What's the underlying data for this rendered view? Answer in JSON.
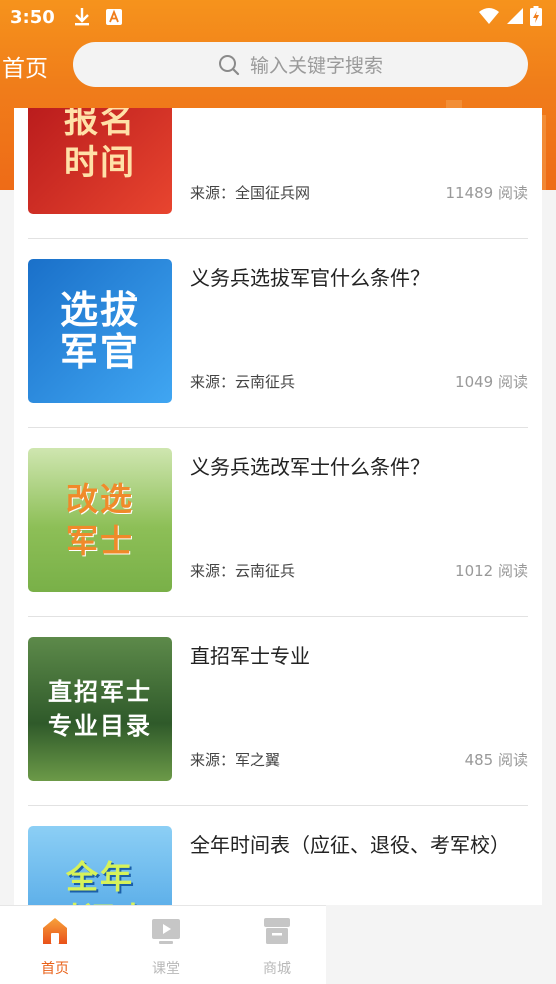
{
  "status_bar": {
    "time": "3:50",
    "download_icon": "download-icon",
    "notification_icon": "font-app-icon",
    "wifi_icon": "wifi-icon",
    "signal_icon": "signal-icon",
    "battery_icon": "battery-charging-icon"
  },
  "header": {
    "title": "首页",
    "search_placeholder": "输入关键字搜索"
  },
  "articles": [
    {
      "title": "",
      "thumb_text": "报名\n时间",
      "source": "来源：全国征兵网",
      "reads": "11489 阅读",
      "thumb_colors": [
        "#c21f1f",
        "#e34b2e"
      ]
    },
    {
      "title": "义务兵选拔军官什么条件？",
      "thumb_text": "选拔\n军官",
      "source": "来源：云南征兵",
      "reads": "1049 阅读",
      "thumb_colors": [
        "#1e7fd6",
        "#3aa0ef"
      ]
    },
    {
      "title": "义务兵选改军士什么条件？",
      "thumb_text": "改选\n军士",
      "source": "来源：云南征兵",
      "reads": "1012 阅读",
      "thumb_colors": [
        "#8fc25a",
        "#b6d98a"
      ]
    },
    {
      "title": "直招军士专业",
      "thumb_text": "直招军士\n专业目录",
      "source": "来源：军之翼",
      "reads": "485 阅读",
      "thumb_colors": [
        "#3e6b34",
        "#7ea55b"
      ]
    },
    {
      "title": "全年时间表（应征、退役、考军校）",
      "thumb_text": "全年\n时间表",
      "source": "",
      "reads": "",
      "thumb_colors": [
        "#3c9be3",
        "#8fd1f7"
      ]
    }
  ],
  "tabbar": {
    "items": [
      {
        "label": "首页",
        "icon": "home-icon",
        "active": true
      },
      {
        "label": "课堂",
        "icon": "video-play-icon",
        "active": false
      },
      {
        "label": "商城",
        "icon": "store-icon",
        "active": false
      }
    ]
  },
  "colors": {
    "accent": "#f07d1a",
    "active_tab": "#e9621a",
    "inactive_tab": "#b9b9b9"
  }
}
